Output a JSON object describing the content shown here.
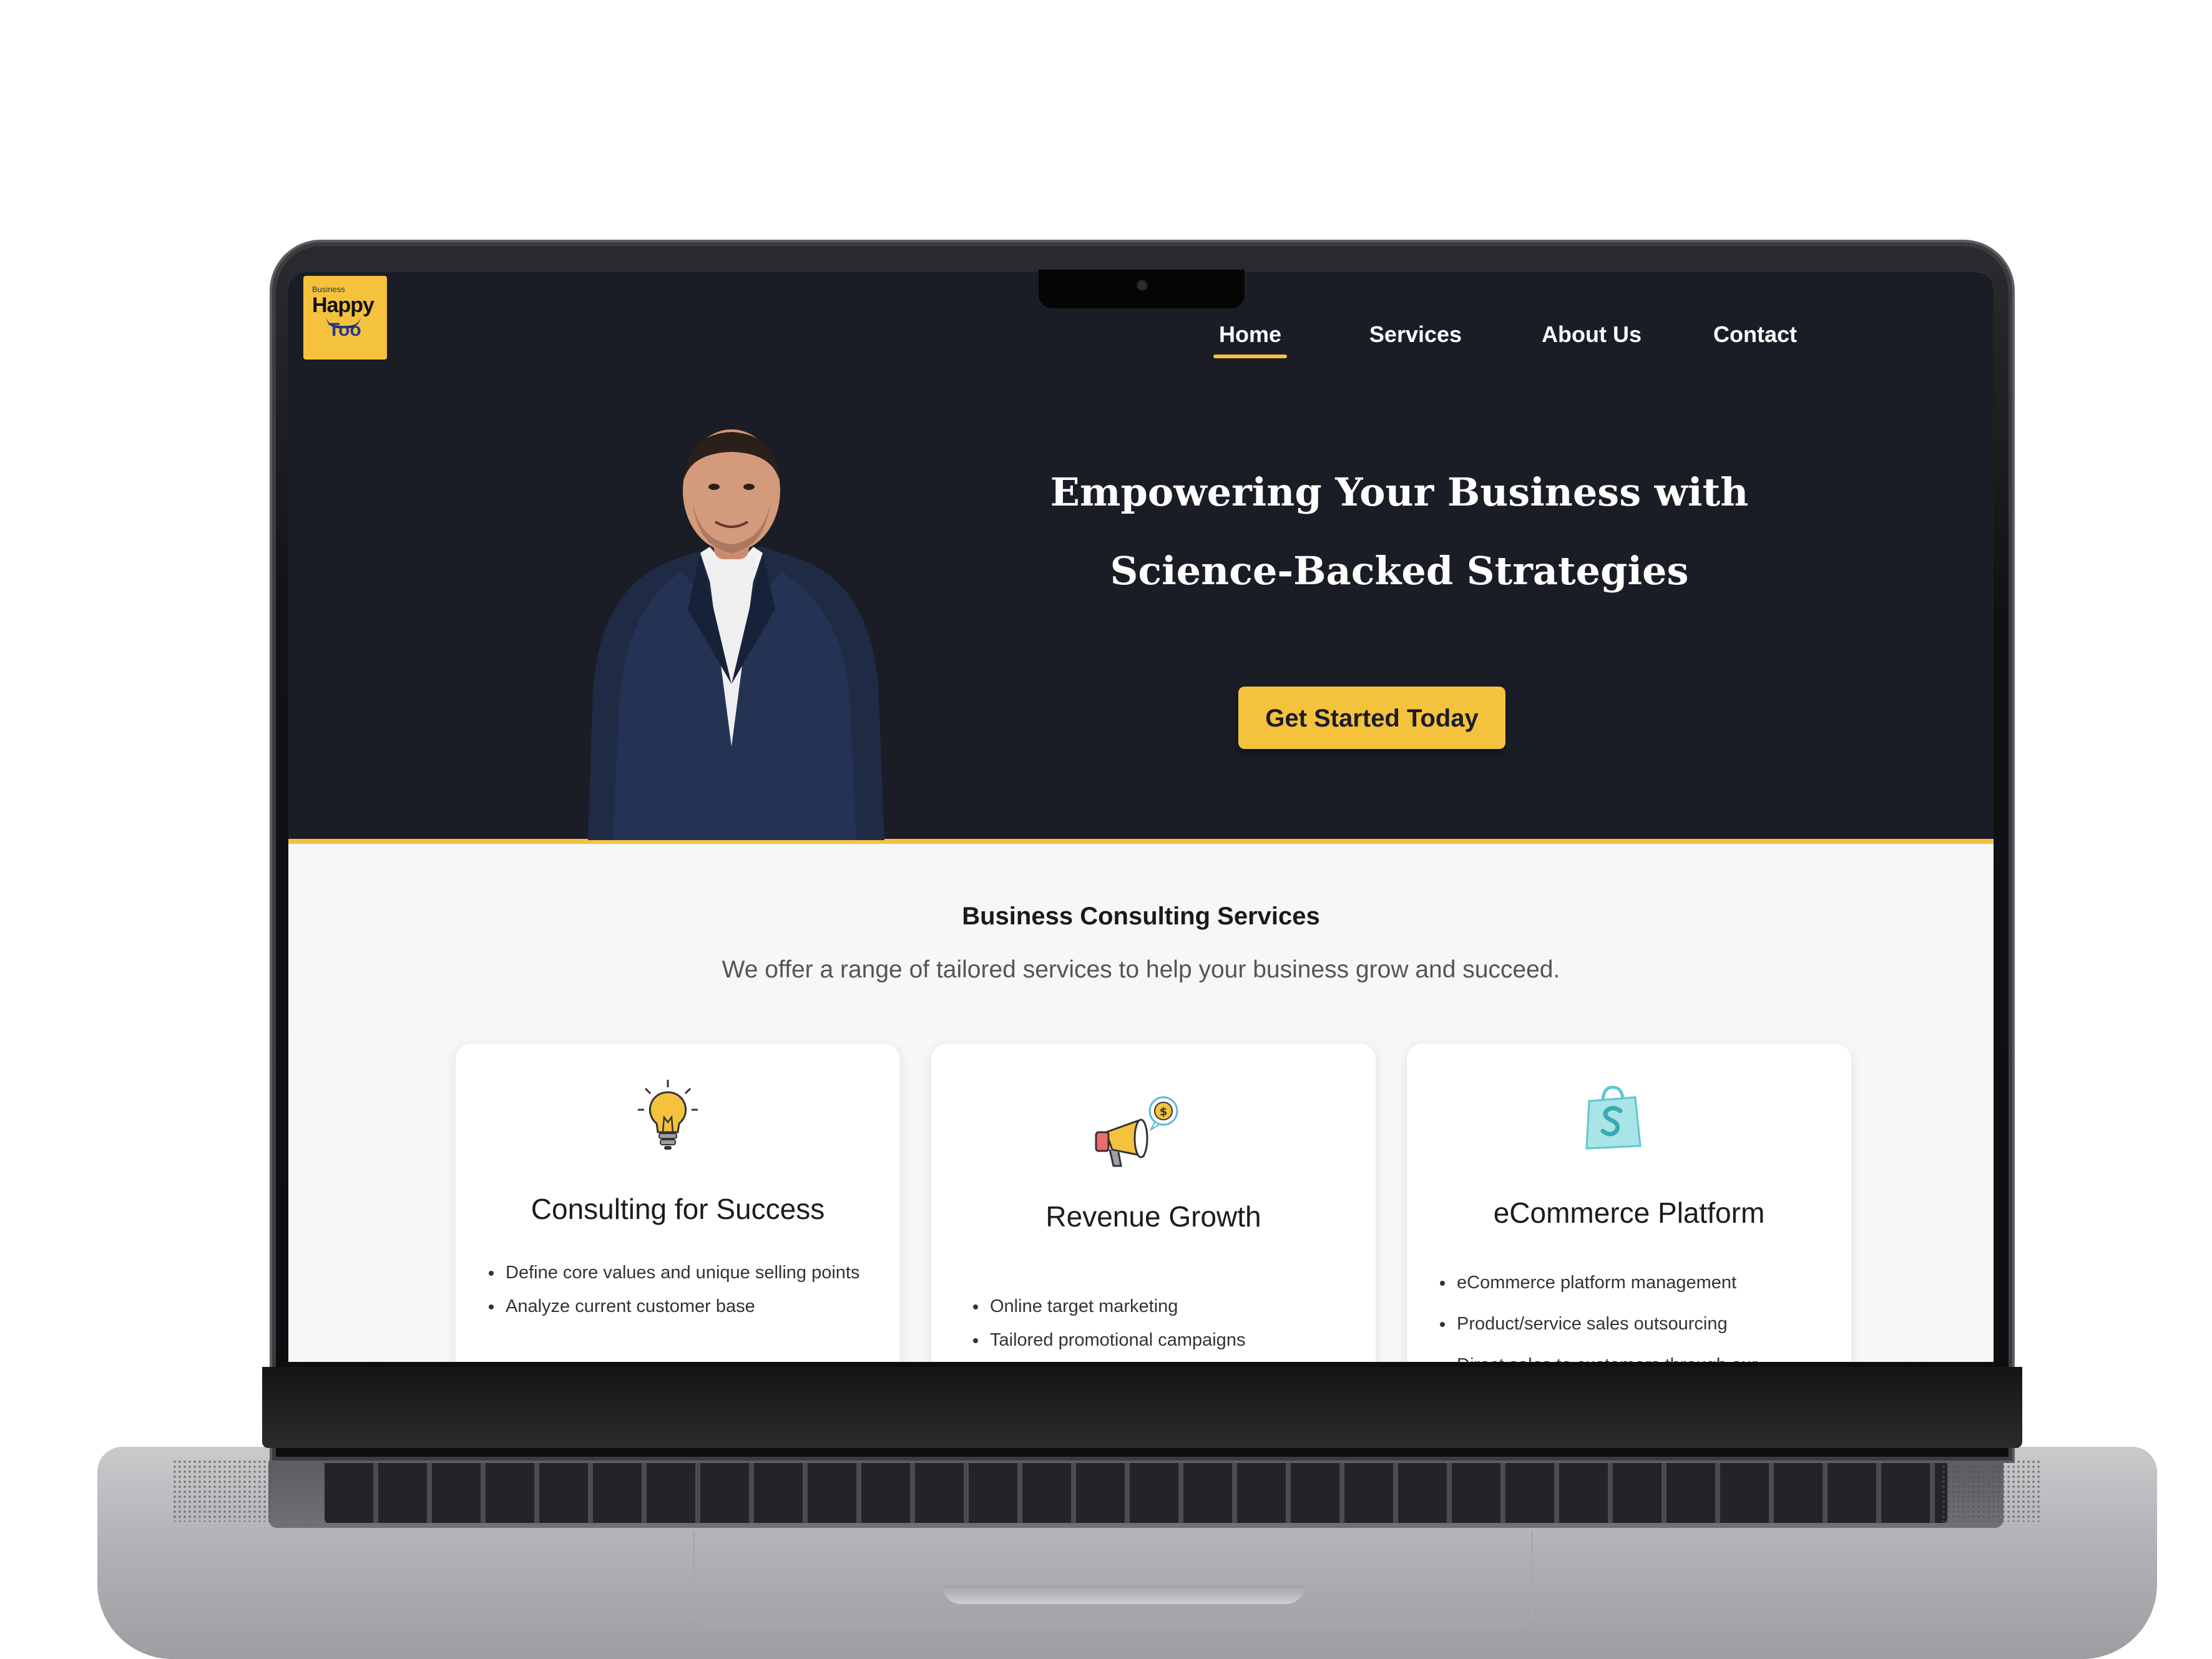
{
  "logo": {
    "line1": "Business",
    "line2": "Happy",
    "line3": "Too"
  },
  "nav": {
    "items": [
      {
        "label": "Home",
        "active": true
      },
      {
        "label": "Services",
        "active": false
      },
      {
        "label": "About Us",
        "active": false
      },
      {
        "label": "Contact",
        "active": false
      }
    ]
  },
  "hero": {
    "title_line1": "Empowering Your Business with",
    "title_line2": "Science-Backed Strategies",
    "cta_label": "Get Started Today"
  },
  "services": {
    "title": "Business Consulting Services",
    "subtitle": "We offer a range of tailored services to help your business grow and succeed.",
    "cards": [
      {
        "icon": "lightbulb-icon",
        "title": "Consulting for Success",
        "items": [
          "Define core values and unique selling points",
          "Analyze current customer base"
        ]
      },
      {
        "icon": "megaphone-icon",
        "title": "Revenue Growth",
        "items": [
          "Online target marketing",
          "Tailored promotional campaigns"
        ]
      },
      {
        "icon": "shopping-bag-icon",
        "title": "eCommerce Platform",
        "items": [
          "eCommerce platform management",
          "Product/service sales outsourcing",
          "Direct sales to customers through our"
        ]
      }
    ]
  },
  "colors": {
    "accent": "#f5c23e",
    "hero_bg": "#1b1d26",
    "page_bg": "#f7f7f7"
  }
}
